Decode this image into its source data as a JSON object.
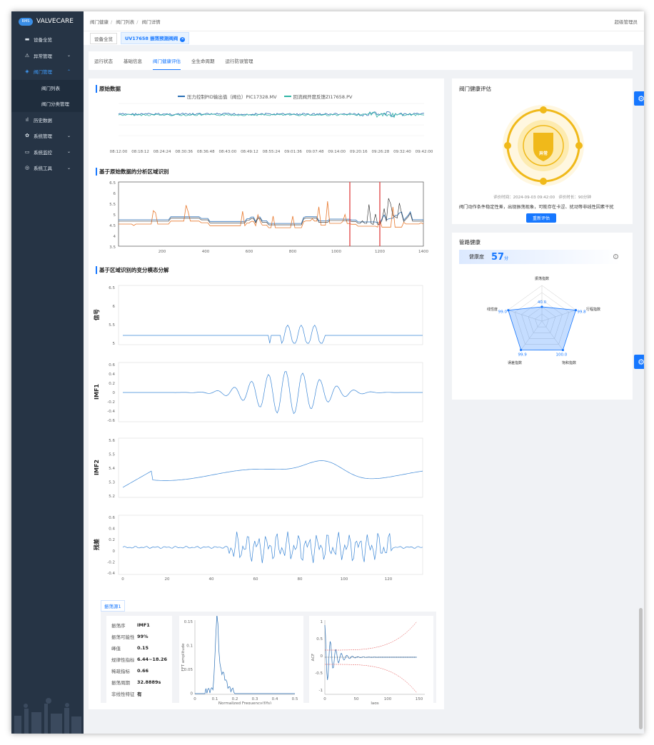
{
  "app": {
    "brand": "VALVECARE",
    "badge": "RMS"
  },
  "sidebar": {
    "items": [
      {
        "label": "设备全览",
        "icon": "dashboard-icon"
      },
      {
        "label": "异常管理",
        "icon": "warning-icon"
      },
      {
        "label": "阀门管理",
        "icon": "layers-icon"
      },
      {
        "label": "历史数据",
        "icon": "chart-icon"
      },
      {
        "label": "系统管理",
        "icon": "gear-icon"
      },
      {
        "label": "系统监控",
        "icon": "monitor-icon"
      },
      {
        "label": "系统工具",
        "icon": "tool-icon"
      }
    ],
    "sub": [
      "阀门列表",
      "阀门分类管理"
    ]
  },
  "header": {
    "breadcrumb": [
      "阀门健康",
      "阀门列表",
      "阀门详情"
    ],
    "user": "超级管理员"
  },
  "tagbar": {
    "tag1": "设备全览",
    "tag2": "UV17658 振荡预测阀阀"
  },
  "tabs": [
    "运行状态",
    "基础信息",
    "阀门健康评估",
    "全生命周期",
    "运行防误管理"
  ],
  "raw": {
    "title": "原始数据",
    "legend1": "压力控制PID输出值（阀位）PIC17328.MV",
    "legend2": "回流阀开度反馈ZI17658.PV",
    "xticks": [
      "08:12:00",
      "08:18:12",
      "08:24:24",
      "08:30:36",
      "08:36:48",
      "08:43:00",
      "08:49:12",
      "08:55:24",
      "09:01:36",
      "09:07:48",
      "09:14:00",
      "09:20:16",
      "09:26:28",
      "09:32:40",
      "09:42:00"
    ]
  },
  "region": {
    "title": "基于原始数据的分析区域识别",
    "yticks": [
      "6.5",
      "6",
      "5.5",
      "5",
      "4.5",
      "4",
      "3.5"
    ],
    "xticks": [
      "200",
      "400",
      "600",
      "800",
      "1000",
      "1200",
      "1400"
    ]
  },
  "decomp": {
    "title": "基于区域识别的变分模态分解",
    "labels": [
      "信号",
      "IMF1",
      "IMF2",
      "残差"
    ],
    "y1": [
      "6.5",
      "6",
      "5.5",
      "5"
    ],
    "y2": [
      "0.6",
      "0.4",
      "0.2",
      "0",
      "-0.2",
      "-0.4",
      "-0.6"
    ],
    "y3": [
      "5.6",
      "5.5",
      "5.4",
      "5.3",
      "5.2"
    ],
    "y4": [
      "0.6",
      "0.4",
      "0.2",
      "0",
      "-0.2",
      "-0.4"
    ],
    "xticks": [
      "0",
      "20",
      "40",
      "60",
      "80",
      "100",
      "120"
    ]
  },
  "osc": {
    "tab": "振荡源1",
    "rows": [
      [
        "振荡序",
        "IMF1"
      ],
      [
        "振荡可能性",
        "99%"
      ],
      [
        "峰值",
        "0.15"
      ],
      [
        "规律性指标",
        "6.44~18.26"
      ],
      [
        "稀疏指标",
        "0.66"
      ],
      [
        "振荡周期",
        "32.8889s"
      ],
      [
        "非线性特征",
        "有"
      ]
    ],
    "fft": {
      "ylabel": "FFT amplitude",
      "xlabel": "Normalized Frequency(f/fs)",
      "yticks": [
        "0.15",
        "0.1",
        "0.05",
        "0"
      ],
      "xticks": [
        "0",
        "0.1",
        "0.2",
        "0.3",
        "0.4",
        "0.5"
      ]
    },
    "acf": {
      "ylabel": "ACF",
      "xlabel": "lags",
      "yticks": [
        "1",
        "0.5",
        "0",
        "-0.5",
        "-1"
      ],
      "xticks": [
        "0",
        "50",
        "100",
        "150"
      ]
    }
  },
  "health": {
    "title": "阀门健康评估",
    "badge": "异常",
    "time": "评价时间：2024-09-03 09:42:00",
    "dur": "评价时长：90分钟",
    "desc": "阀门动作条件稳定性差，出现振荡现象，可能存在卡涩、扰动等非线性因素干扰",
    "button": "重新评估"
  },
  "pipe": {
    "title": "管路健康",
    "label": "健康度",
    "score": "57",
    "unit": "分",
    "radar": [
      {
        "name": "振荡指数",
        "value": "40.0"
      },
      {
        "name": "行程指数",
        "value": "99.8"
      },
      {
        "name": "饱和指数",
        "value": "100.0"
      },
      {
        "name": "误差指数",
        "value": "99.9"
      },
      {
        "name": "线性度",
        "value": "99.0"
      }
    ]
  },
  "colors": {
    "accent": "#1677ff",
    "orange": "#e8782d",
    "red": "#e04040",
    "teal": "#2fb5a5",
    "gold": "#f0b91a"
  }
}
